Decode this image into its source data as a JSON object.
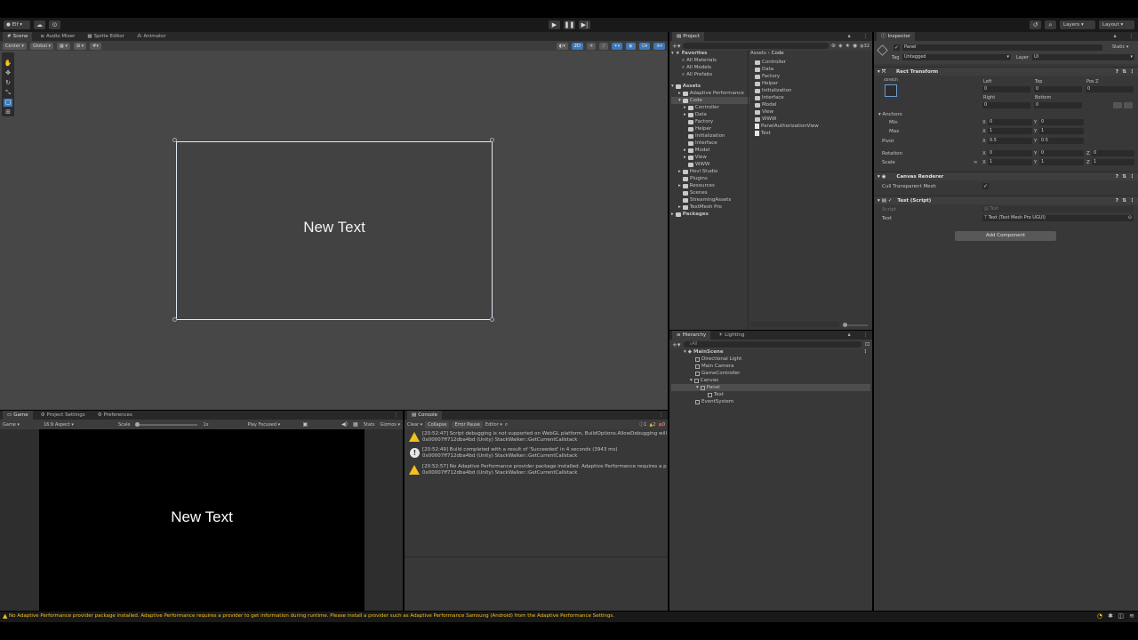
{
  "top_toolbar": {
    "account_label": "Elf",
    "layers_label": "Layers",
    "layout_label": "Layout"
  },
  "scene": {
    "tabs": [
      "Scene",
      "Audio Mixer",
      "Sprite Editor",
      "Animator"
    ],
    "pivot_label": "Center",
    "space_label": "Global",
    "mode_2d": "2D",
    "text": "New Text"
  },
  "game": {
    "tabs": [
      "Game",
      "Project Settings",
      "Preferences"
    ],
    "display_label": "Game",
    "aspect_label": "16:9 Aspect",
    "scale_label": "Scale",
    "scale_value": "1x",
    "play_focused_label": "Play Focused",
    "stats_label": "Stats",
    "gizmos_label": "Gizmos",
    "text": "New Text"
  },
  "console": {
    "tab": "Console",
    "clear_label": "Clear",
    "collapse_label": "Collapse",
    "error_pause_label": "Error Pause",
    "editor_label": "Editor",
    "count_warn": "2",
    "count_info": "1",
    "count_err": "0",
    "entries": [
      {
        "type": "warning",
        "line1": "[20:52:47] Script debugging is not supported on WebGL platform, BuildOptions.AllowDebugging will",
        "line2": "0x00007ff712dba4bd (Unity) StackWalker::GetCurrentCallstack"
      },
      {
        "type": "info",
        "line1": "[20:52:49] Build completed with a result of 'Succeeded' in 4 seconds (3943 ms)",
        "line2": "0x00007ff712dba4bd (Unity) StackWalker::GetCurrentCallstack"
      },
      {
        "type": "warning",
        "line1": "[20:52:57] No Adaptive Performance provider package installed. Adaptive Performance requires a p",
        "line2": "0x00007ff712dba4bd (Unity) StackWalker::GetCurrentCallstack"
      }
    ]
  },
  "project": {
    "tab": "Project",
    "count_label": "32",
    "favorites_label": "Favorites",
    "favorites": [
      "All Materials",
      "All Models",
      "All Prefabs"
    ],
    "assets_label": "Assets",
    "assets_tree": [
      {
        "label": "Adaptive Performance",
        "depth": 1
      },
      {
        "label": "Code",
        "depth": 1
      },
      {
        "label": "Controller",
        "depth": 2
      },
      {
        "label": "Data",
        "depth": 2
      },
      {
        "label": "Factory",
        "depth": 2
      },
      {
        "label": "Helper",
        "depth": 2
      },
      {
        "label": "Initialization",
        "depth": 2
      },
      {
        "label": "Interface",
        "depth": 2
      },
      {
        "label": "Model",
        "depth": 2
      },
      {
        "label": "View",
        "depth": 2
      },
      {
        "label": "WWW",
        "depth": 2
      },
      {
        "label": "Hovl Studio",
        "depth": 1
      },
      {
        "label": "Plugins",
        "depth": 1
      },
      {
        "label": "Resources",
        "depth": 1
      },
      {
        "label": "Scenes",
        "depth": 1
      },
      {
        "label": "StreamingAssets",
        "depth": 1
      },
      {
        "label": "TextMesh Pro",
        "depth": 1
      }
    ],
    "packages_label": "Packages",
    "breadcrumb": [
      "Assets",
      "Code"
    ],
    "files": [
      {
        "label": "Controller",
        "kind": "folder"
      },
      {
        "label": "Data",
        "kind": "folder"
      },
      {
        "label": "Factory",
        "kind": "folder"
      },
      {
        "label": "Helper",
        "kind": "folder"
      },
      {
        "label": "Initialization",
        "kind": "folder"
      },
      {
        "label": "Interface",
        "kind": "folder"
      },
      {
        "label": "Model",
        "kind": "folder"
      },
      {
        "label": "View",
        "kind": "folder"
      },
      {
        "label": "WWW",
        "kind": "folder"
      },
      {
        "label": "PanelAuthorizationView",
        "kind": "file"
      },
      {
        "label": "Test",
        "kind": "file"
      }
    ]
  },
  "hierarchy": {
    "tabs": [
      "Hierarchy",
      "Lighting"
    ],
    "search_placeholder": "All",
    "scene_label": "MainScene",
    "items": [
      {
        "label": "Directional Light",
        "depth": 1
      },
      {
        "label": "Main Camera",
        "depth": 1
      },
      {
        "label": "GameController",
        "depth": 1
      },
      {
        "label": "Canvas",
        "depth": 1
      },
      {
        "label": "Panel",
        "depth": 2
      },
      {
        "label": "Text",
        "depth": 3
      },
      {
        "label": "EventSystem",
        "depth": 1
      }
    ]
  },
  "inspector": {
    "tab": "Inspector",
    "object_name": "Panel",
    "static_label": "Static",
    "tag_label": "Tag",
    "tag_value": "Untagged",
    "layer_label": "Layer",
    "layer_value": "UI",
    "rect_transform": {
      "title": "Rect Transform",
      "stretch_label": "stretch",
      "left_label": "Left",
      "left_value": "0",
      "top_label": "Top",
      "top_value": "0",
      "posz_label": "Pos Z",
      "posz_value": "0",
      "right_label": "Right",
      "right_value": "0",
      "bottom_label": "Bottom",
      "bottom_value": "0",
      "anchors_label": "Anchors",
      "min_label": "Min",
      "min_x": "0",
      "min_y": "0",
      "max_label": "Max",
      "max_x": "1",
      "max_y": "1",
      "pivot_label": "Pivot",
      "pivot_x": "0.5",
      "pivot_y": "0.5",
      "rotation_label": "Rotation",
      "rot_x": "0",
      "rot_y": "0",
      "rot_z": "0",
      "scale_label": "Scale",
      "scale_x": "1",
      "scale_y": "1",
      "scale_z": "1"
    },
    "canvas_renderer": {
      "title": "Canvas Renderer",
      "cull_label": "Cull Transparent Mesh",
      "cull_value": "✓"
    },
    "test_script": {
      "title": "Test (Script)",
      "script_label": "Script",
      "script_value": "Test",
      "text_label": "Text",
      "text_value": "Text (Text Mesh Pro UGUI)"
    },
    "add_component_label": "Add Component"
  },
  "status_bar": {
    "message": "No Adaptive Performance provider package installed. Adaptive Performance requires a provider to get information during runtime. Please install a provider such as Adaptive Performance Samsung (Android) from the Adaptive Performance Settings."
  },
  "colors": {
    "accent_blue": "#3a79bb",
    "warning_yellow": "#f2c11e",
    "panel_bg": "#383838",
    "scene_bg": "#474747"
  }
}
